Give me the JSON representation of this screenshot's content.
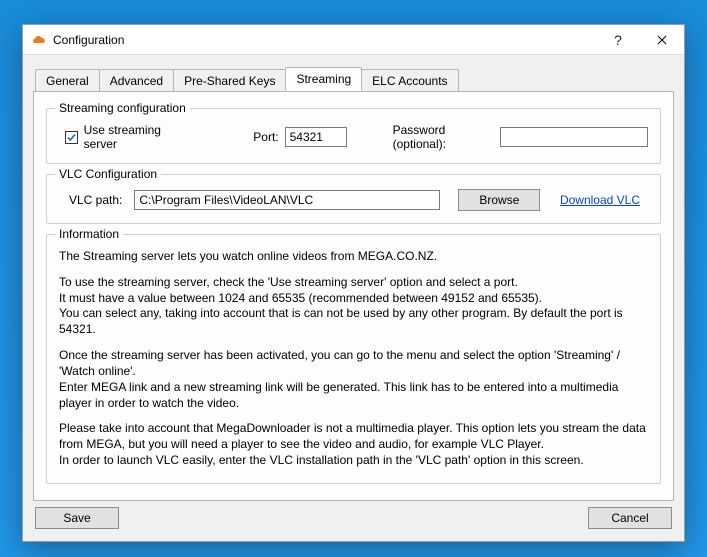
{
  "window": {
    "title": "Configuration",
    "help_label": "?",
    "close_label": "✕"
  },
  "tabs": {
    "general": "General",
    "advanced": "Advanced",
    "pre_shared_keys": "Pre-Shared Keys",
    "streaming": "Streaming",
    "elc_accounts": "ELC Accounts"
  },
  "streaming_group": {
    "legend": "Streaming configuration",
    "use_server_label": "Use streaming server",
    "use_server_checked": true,
    "port_label": "Port:",
    "port_value": "54321",
    "password_label": "Password (optional):",
    "password_value": ""
  },
  "vlc_group": {
    "legend": "VLC Configuration",
    "path_label": "VLC path:",
    "path_value": "C:\\Program Files\\VideoLAN\\VLC",
    "browse_label": "Browse",
    "download_label": "Download VLC"
  },
  "info_group": {
    "legend": "Information",
    "p1": "The Streaming server lets you watch online videos from MEGA.CO.NZ.",
    "p2": "To use the streaming server, check the 'Use streaming server' option and select a port.\nIt must have a value between 1024 and 65535 (recommended between 49152 and 65535).\nYou can select any, taking into account that is can not be used by any other program. By default the port is 54321.",
    "p3": "Once the streaming server has been activated, you can go to the menu and select the option 'Streaming' / 'Watch online'.\nEnter MEGA link and a new streaming link will be generated. This link has to be entered into a multimedia player in order to watch the video.",
    "p4": "Please take into account that MegaDownloader is not a multimedia player. This option lets you stream the data from MEGA, but you will need a player to see the video and audio, for example VLC Player.\nIn order to launch VLC easily, enter the VLC installation path in the 'VLC path' option in this screen."
  },
  "footer": {
    "save": "Save",
    "cancel": "Cancel"
  },
  "colors": {
    "icon_orange": "#ee7b1c"
  }
}
